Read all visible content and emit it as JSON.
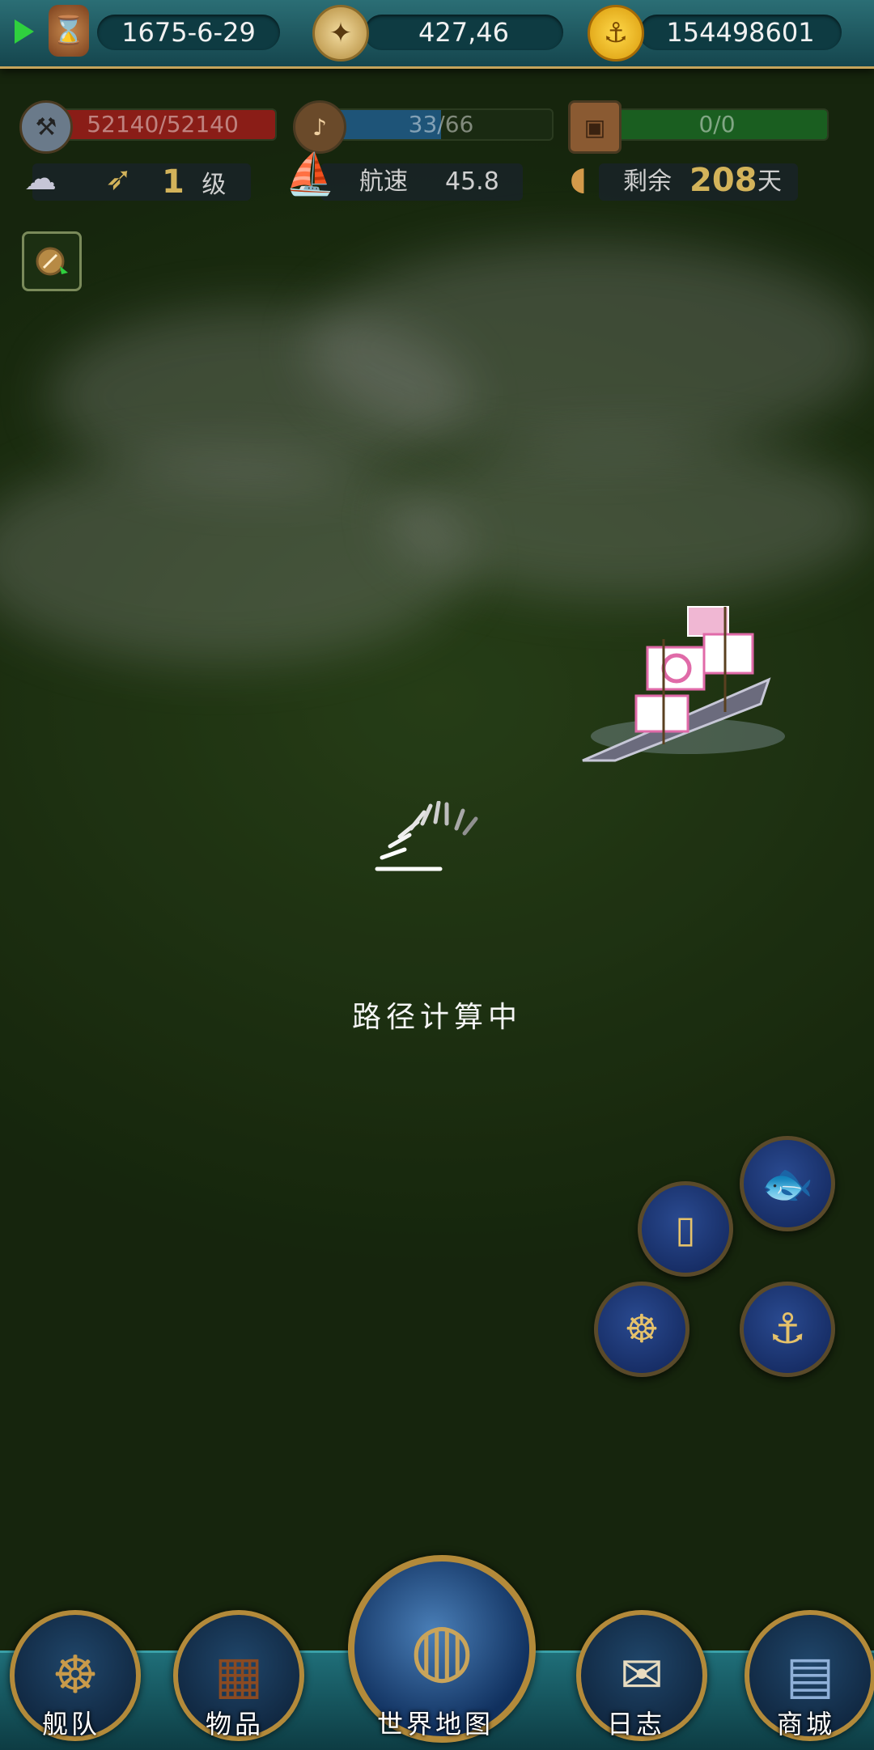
{
  "top_bar": {
    "date": "1675-6-29",
    "coordinates": "427,46",
    "gold": "154498601"
  },
  "status": {
    "durability": {
      "text": "52140/52140",
      "fill": 1.0,
      "color": "#b0261e",
      "icon": "hammer-icon"
    },
    "crew": {
      "text": "33/66",
      "fill": 0.5,
      "color": "#1f5d86",
      "icon": "crew-icon"
    },
    "cargo": {
      "text": "0/0",
      "fill": 1.0,
      "color": "#1f6a24",
      "icon": "crate-icon"
    }
  },
  "info": {
    "wind_level_num": "1",
    "wind_level_unit": "级",
    "speed_label": "航速",
    "speed_value": "45.8",
    "remaining_label": "剩余",
    "remaining_days": "208",
    "remaining_unit": "天"
  },
  "loading": {
    "text": "路径计算中"
  },
  "actions": [
    "fish-icon",
    "barrel-icon",
    "helm-rope-icon",
    "anchor-icon"
  ],
  "nav": {
    "fleet": "舰队",
    "items": "物品",
    "world_map": "世界地图",
    "log": "日志",
    "shop": "商城"
  }
}
